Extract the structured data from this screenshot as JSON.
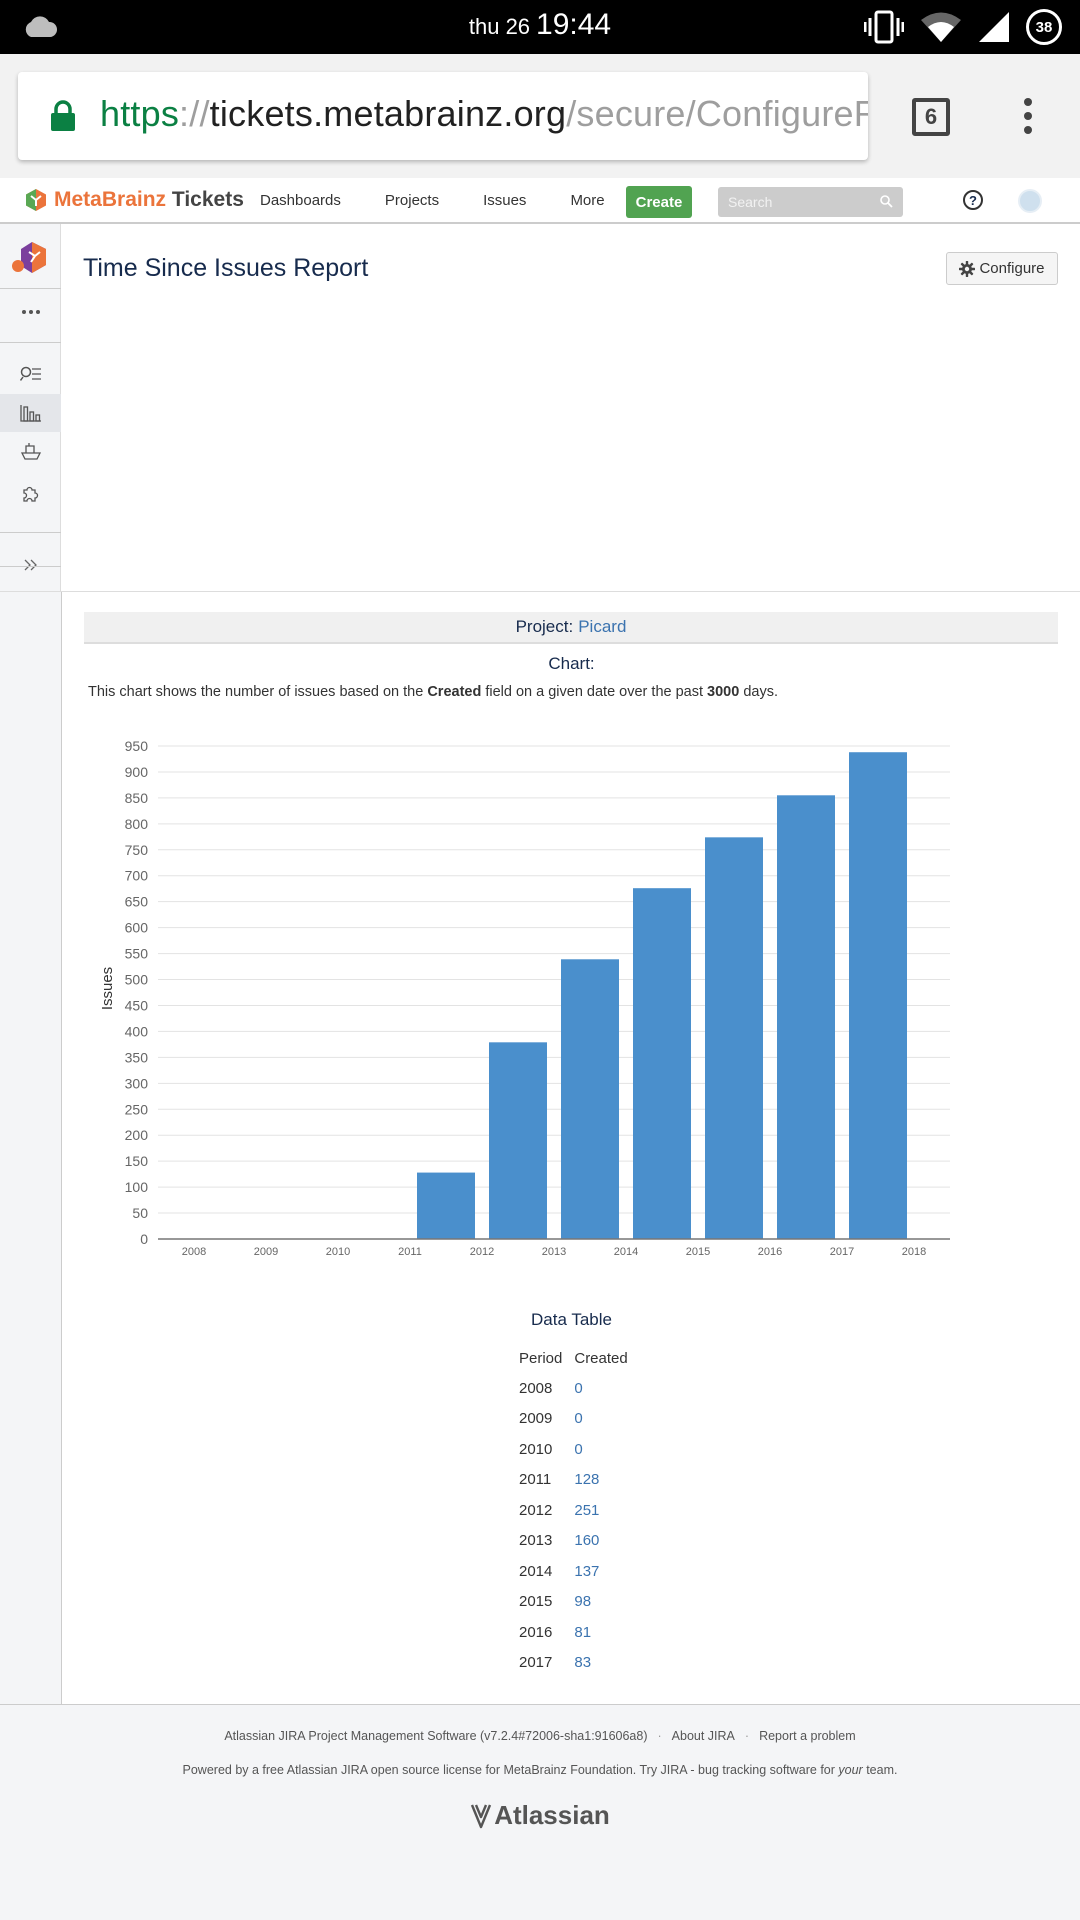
{
  "status_bar": {
    "day": "thu 26",
    "time": "19:44",
    "battery": "38"
  },
  "browser": {
    "url_scheme": "https",
    "url_separator": "://",
    "url_host": "tickets.metabrainz.org",
    "url_path": "/secure/ConfigureR",
    "tab_count": "6"
  },
  "header": {
    "logo_meta": "Meta",
    "logo_brainz": "Brainz",
    "logo_tickets": "Tickets",
    "nav": [
      "Dashboards",
      "Projects",
      "Issues",
      "More"
    ],
    "create_label": "Create",
    "search_placeholder": "Search",
    "help_label": "?"
  },
  "page": {
    "title": "Time Since Issues Report",
    "configure_label": "Configure",
    "project_label": "Project:",
    "project_name": "Picard",
    "chart_label": "Chart:",
    "desc_1": "This chart shows the number of issues based on the ",
    "desc_field": "Created",
    "desc_2": " field on a given date over the past ",
    "desc_days": "3000",
    "desc_3": " days."
  },
  "chart_data": {
    "type": "bar",
    "categories": [
      "2008",
      "2009",
      "2010",
      "2011",
      "2012",
      "2013",
      "2014",
      "2015",
      "2016",
      "2017"
    ],
    "values": [
      0,
      0,
      0,
      128,
      379,
      539,
      676,
      774,
      855,
      938
    ],
    "x_ticks": [
      "2008",
      "2009",
      "2010",
      "2011",
      "2012",
      "2013",
      "2014",
      "2015",
      "2016",
      "2017",
      "2018"
    ],
    "y_ticks": [
      0,
      50,
      100,
      150,
      200,
      250,
      300,
      350,
      400,
      450,
      500,
      550,
      600,
      650,
      700,
      750,
      800,
      850,
      900,
      950
    ],
    "ylabel": "Issues",
    "xlabel": "",
    "ylim": [
      0,
      950
    ],
    "grid": true,
    "bar_color": "#4a8fcc"
  },
  "data_table": {
    "title": "Data Table",
    "headers": [
      "Period",
      "Created"
    ],
    "rows": [
      [
        "2008",
        "0"
      ],
      [
        "2009",
        "0"
      ],
      [
        "2010",
        "0"
      ],
      [
        "2011",
        "128"
      ],
      [
        "2012",
        "251"
      ],
      [
        "2013",
        "160"
      ],
      [
        "2014",
        "137"
      ],
      [
        "2015",
        "98"
      ],
      [
        "2016",
        "81"
      ],
      [
        "2017",
        "83"
      ]
    ]
  },
  "footer": {
    "software": "Atlassian JIRA Project Management Software (v7.2.4#72006-sha1:91606a8)",
    "about": "About JIRA",
    "report": "Report a problem",
    "powered_1": "Powered by a free Atlassian JIRA open source license for MetaBrainz Foundation. Try JIRA - bug tracking software for ",
    "powered_em": "your",
    "powered_2": " team.",
    "brand": "Atlassian"
  },
  "colors": {
    "link": "#3b73af",
    "create": "#51a351",
    "url_green": "#0b8043"
  }
}
